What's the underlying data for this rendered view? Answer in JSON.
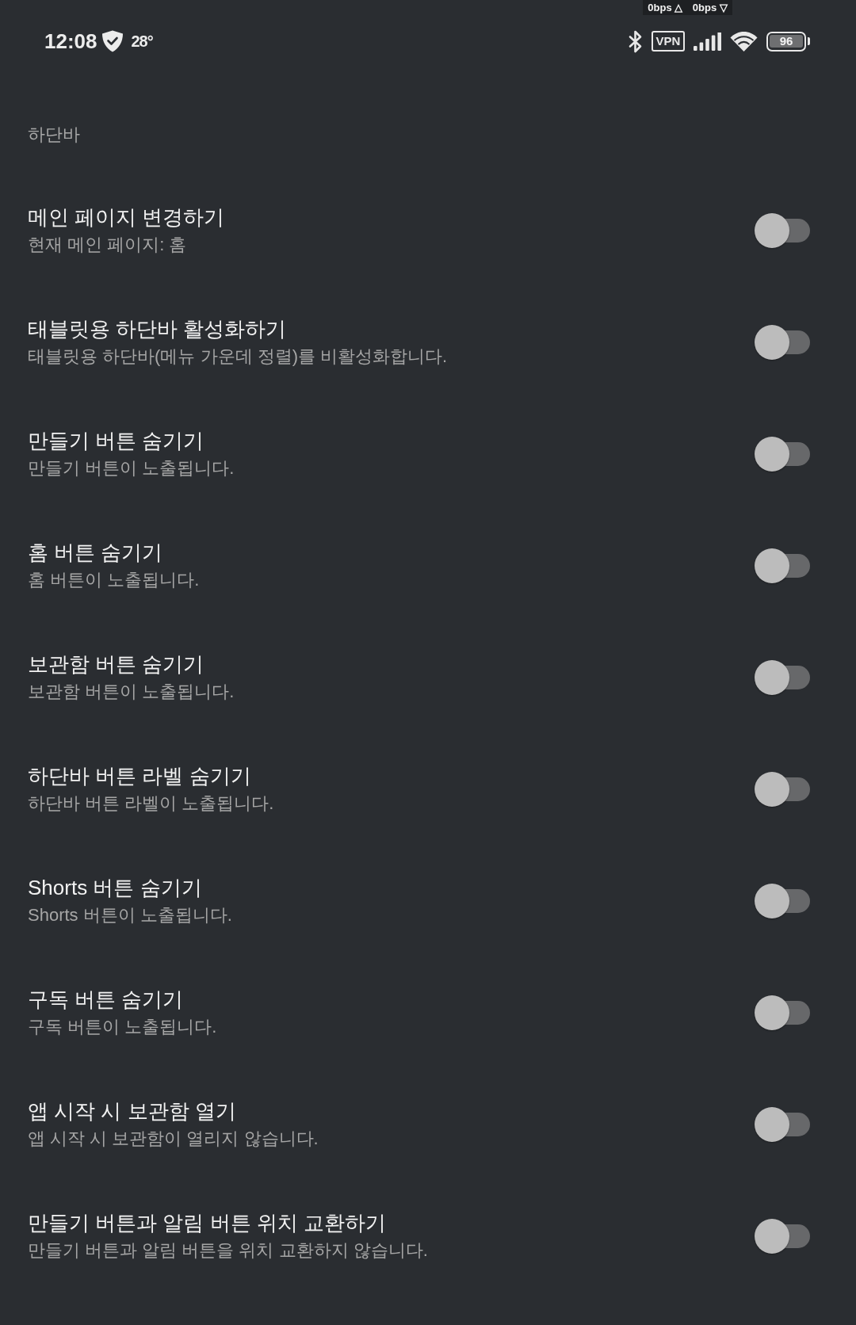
{
  "status_bar": {
    "time": "12:08",
    "temperature": "28°",
    "network_speed": [
      "0bps △",
      "0bps ▽"
    ],
    "vpn": "VPN",
    "battery": "96"
  },
  "section": {
    "title": "하단바"
  },
  "settings": [
    {
      "title": "메인 페이지 변경하기",
      "subtitle": "현재 메인 페이지: 홈",
      "on": false
    },
    {
      "title": "태블릿용 하단바 활성화하기",
      "subtitle": "태블릿용 하단바(메뉴 가운데 정렬)를 비활성화합니다.",
      "on": false
    },
    {
      "title": "만들기 버튼 숨기기",
      "subtitle": "만들기 버튼이 노출됩니다.",
      "on": false
    },
    {
      "title": "홈 버튼 숨기기",
      "subtitle": "홈 버튼이 노출됩니다.",
      "on": false
    },
    {
      "title": "보관함 버튼 숨기기",
      "subtitle": "보관함 버튼이 노출됩니다.",
      "on": false
    },
    {
      "title": "하단바 버튼 라벨 숨기기",
      "subtitle": "하단바 버튼 라벨이 노출됩니다.",
      "on": false
    },
    {
      "title": "Shorts 버튼 숨기기",
      "subtitle": "Shorts 버튼이 노출됩니다.",
      "on": false
    },
    {
      "title": "구독 버튼 숨기기",
      "subtitle": "구독 버튼이 노출됩니다.",
      "on": false
    },
    {
      "title": "앱 시작 시 보관함 열기",
      "subtitle": "앱 시작 시 보관함이 열리지 않습니다.",
      "on": false
    },
    {
      "title": "만들기 버튼과 알림 버튼 위치 교환하기",
      "subtitle": "만들기 버튼과 알림 버튼을 위치 교환하지 않습니다.",
      "on": false
    }
  ]
}
